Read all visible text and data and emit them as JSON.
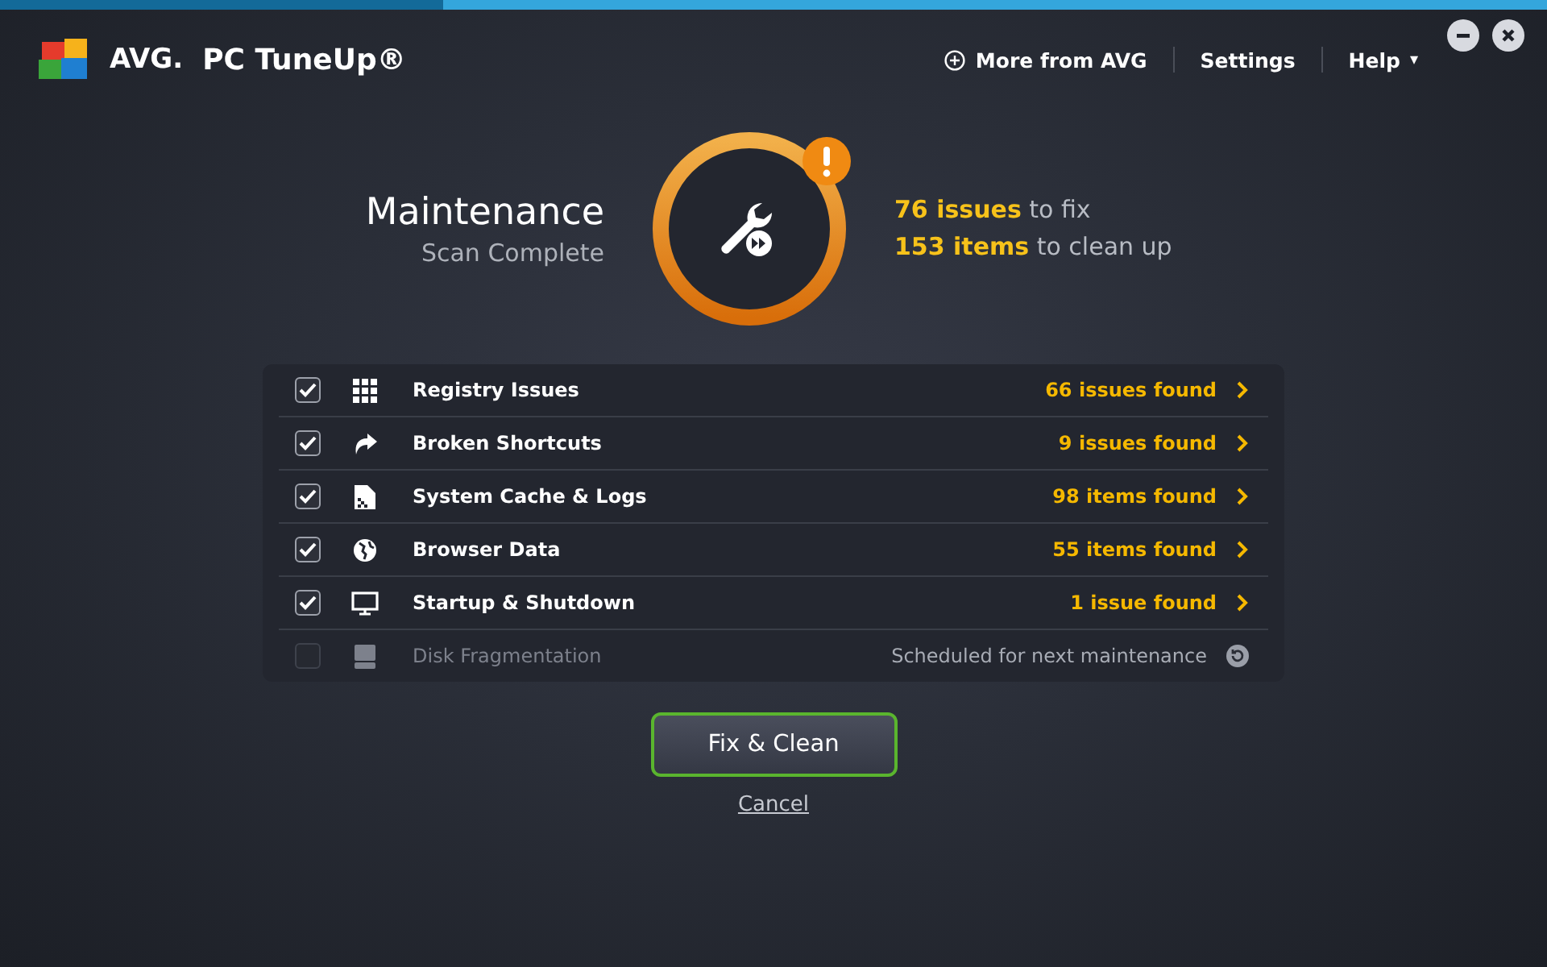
{
  "window": {
    "logo": "AVG.",
    "product": "PC TuneUp®"
  },
  "header_links": [
    {
      "label": "More from AVG",
      "kind": "plus"
    },
    {
      "label": "Settings",
      "kind": "plain"
    },
    {
      "label": "Help",
      "kind": "menu",
      "caret": "▾"
    }
  ],
  "summary": {
    "title": "Maintenance",
    "subtitle": "Scan Complete",
    "lines": [
      "**76 issues** to fix",
      "**153 items** to clean up"
    ]
  },
  "rows": [
    {
      "label": "Registry Issues",
      "result": "66 issues found",
      "checked": true,
      "disabled": false,
      "kind": "finding"
    },
    {
      "label": "Broken Shortcuts",
      "result": "9 issues found",
      "checked": true,
      "disabled": false,
      "kind": "finding"
    },
    {
      "label": "System Cache & Logs",
      "result": "98 items found",
      "checked": true,
      "disabled": false,
      "kind": "finding"
    },
    {
      "label": "Browser Data",
      "result": "55 items found",
      "checked": true,
      "disabled": false,
      "kind": "finding"
    },
    {
      "label": "Startup & Shutdown",
      "result": "1 issue found",
      "checked": true,
      "disabled": false,
      "kind": "finding"
    },
    {
      "label": "Disk Fragmentation",
      "result": "Scheduled for next maintenance",
      "checked": false,
      "disabled": true,
      "kind": "scheduled"
    }
  ],
  "primary_button": "Fix & Clean",
  "cancel_link": "Cancel"
}
